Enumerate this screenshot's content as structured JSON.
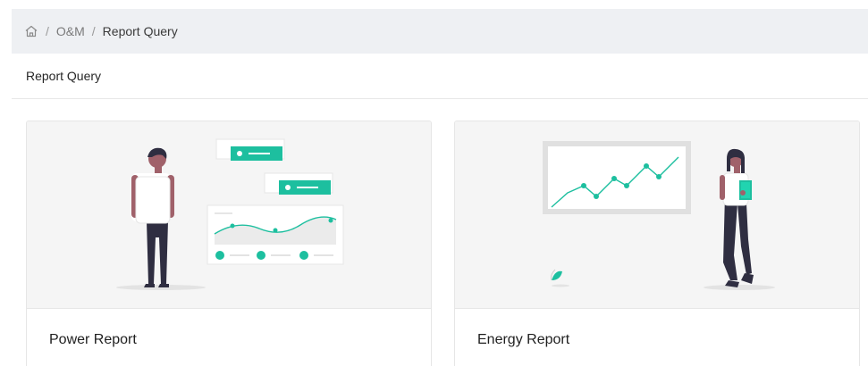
{
  "breadcrumb": {
    "home_icon": "home-icon",
    "separator": "/",
    "items": [
      "O&M",
      "Report Query"
    ]
  },
  "page": {
    "title": "Report Query"
  },
  "cards": [
    {
      "title": "Power Report",
      "illustration": "person-with-dashboard-illustration"
    },
    {
      "title": "Energy Report",
      "illustration": "person-with-growth-chart-illustration"
    }
  ],
  "colors": {
    "accent": "#1dbf9f",
    "breadcrumb_bg": "#eef0f3",
    "card_illustration_bg": "#f5f5f5"
  }
}
